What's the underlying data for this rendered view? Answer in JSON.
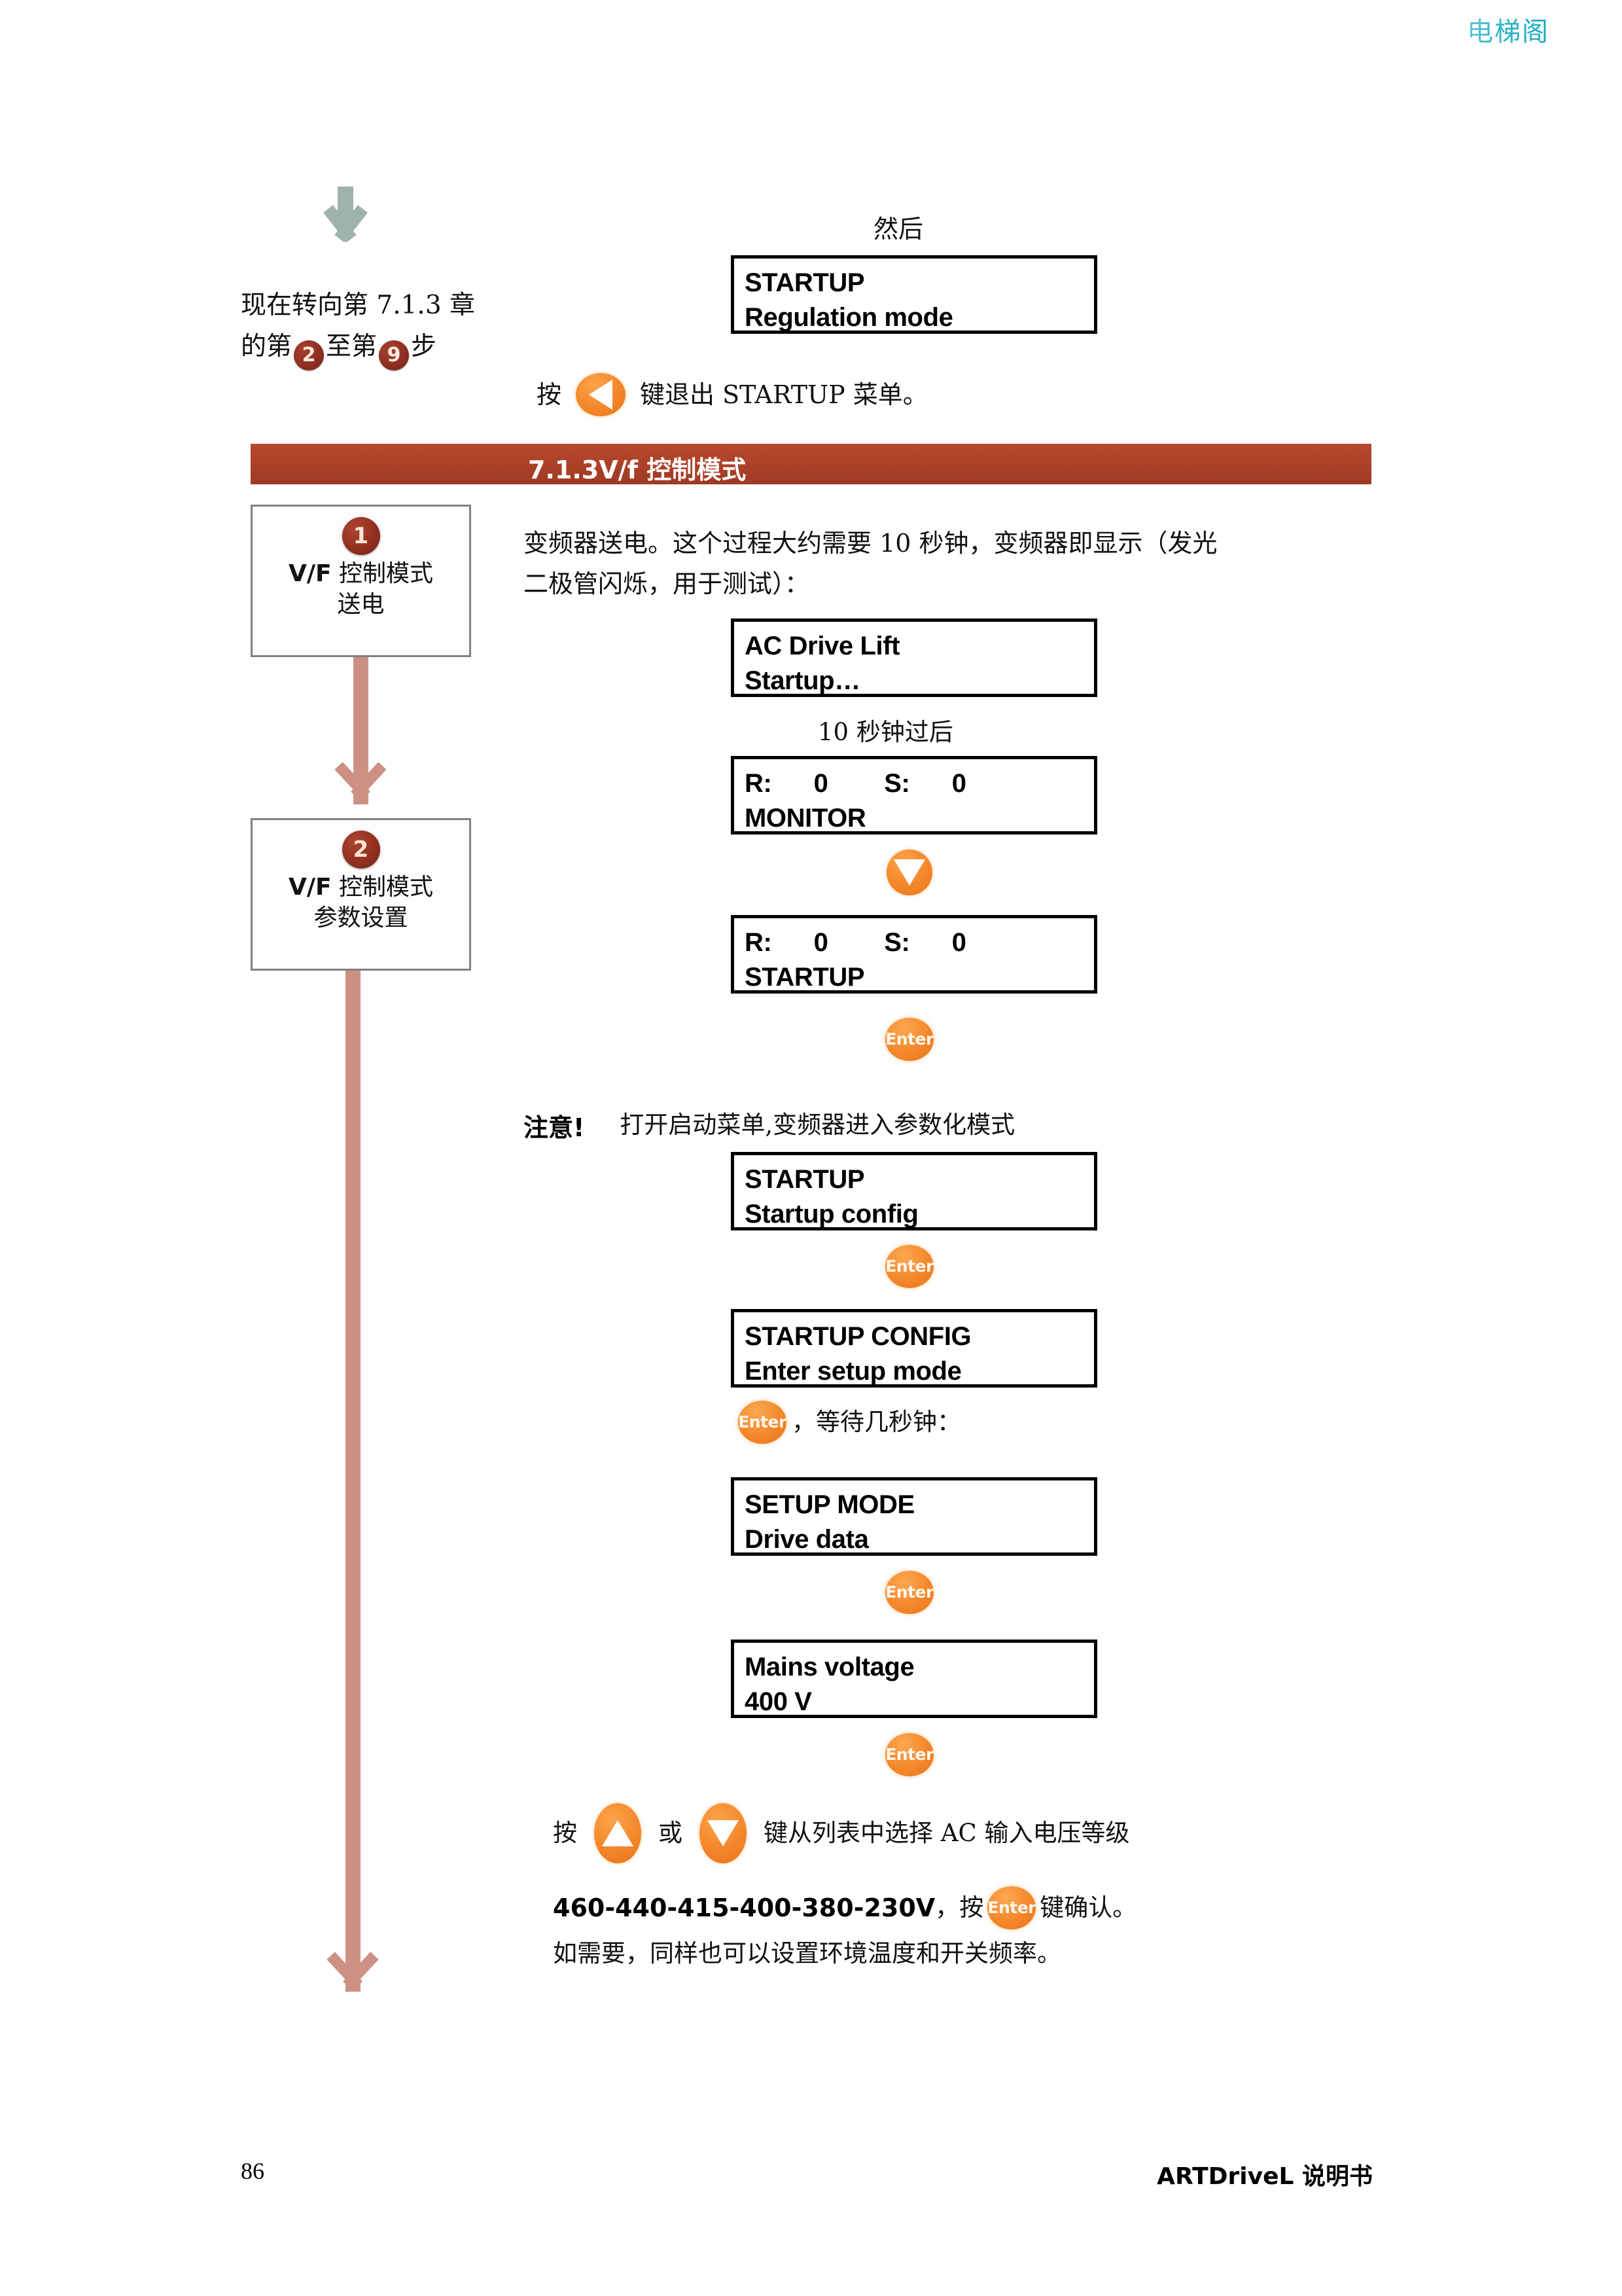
{
  "watermark": "电梯阁",
  "top": {
    "incoming_arrow_icon": "down-arrow-icon",
    "goto_prefix": "现在转向第 7.1.3 章",
    "goto_line2_a": "的第",
    "goto_step_from": "2",
    "goto_line2_b": "至第",
    "goto_step_to": "9",
    "goto_line2_c": "步",
    "then_label": "然后",
    "regulation_lcd": {
      "line1": "STARTUP",
      "line2": "Regulation mode"
    },
    "exit_pre": "按",
    "exit_key_icon": "arrow-left-key-icon",
    "exit_post": "键退出 STARTUP 菜单。",
    "exit_post_bold": "STARTUP"
  },
  "section": {
    "title": "7.1.3V/f 控制模式"
  },
  "flow": {
    "steps": [
      {
        "number": "1",
        "line1_bold": "V/F",
        "line1_rest": "控制模式",
        "line2": "送电"
      },
      {
        "number": "2",
        "line1_bold": "V/F",
        "line1_rest": "控制模式",
        "line2": "参数设置"
      }
    ]
  },
  "body": {
    "intro_line1": "变频器送电。这个过程大约需要 10 秒钟，变频器即显示（发光",
    "intro_line2": "二极管闪烁，用于测试）：",
    "lcd_acdrive": {
      "line1": "AC Drive Lift",
      "line2": "Startup…"
    },
    "after_10s": "10 秒钟过后",
    "lcd_monitor": {
      "line1": "R:      0        S:      0",
      "line2": "MONITOR"
    },
    "key_down_icon": "arrow-down-key-icon",
    "lcd_startup": {
      "line1": "R:      0        S:      0",
      "line2": "STARTUP"
    },
    "key_enter_icon_1": "enter-key-icon",
    "enter_label": "Enter",
    "note_label": "注意!",
    "note_text": "打开启动菜单,变频器进入参数化模式",
    "lcd_startup_config": {
      "line1": "STARTUP",
      "line2": "Startup config"
    },
    "key_enter_icon_2": "enter-key-icon",
    "lcd_startup_config_upper": {
      "line1": "STARTUP CONFIG",
      "line2": "Enter setup mode"
    },
    "wait_note": "，等待几秒钟：",
    "lcd_setup_mode": {
      "line1": "SETUP MODE",
      "line2": "Drive data"
    },
    "key_enter_icon_3": "enter-key-icon",
    "lcd_mains_voltage": {
      "line1": "Mains voltage",
      "line2": "400 V"
    },
    "key_enter_icon_4": "enter-key-icon",
    "select_pre": "按",
    "select_key_up_icon": "arrow-up-key-icon",
    "select_or": "或",
    "select_key_down_icon": "arrow-down-key-icon",
    "select_post": "键从列表中选择 AC 输入电压等级",
    "voltage_list": "460-440-415-400-380-230V",
    "confirm_pre": "，按",
    "confirm_key_icon": "enter-key-icon",
    "confirm_post": "键确认。",
    "optional_line": "如需要，同样也可以设置环境温度和开关频率。"
  },
  "footer": {
    "page_number": "86",
    "manual_name": "ARTDriveL 说明书"
  },
  "colors": {
    "section_bar": "#ad4129",
    "connector": "#cc9184",
    "key_orange": "#f4862a",
    "step_dot": "#93301f",
    "watermark": "#2fb5c8",
    "grey_arrow": "#9fb3ad"
  }
}
